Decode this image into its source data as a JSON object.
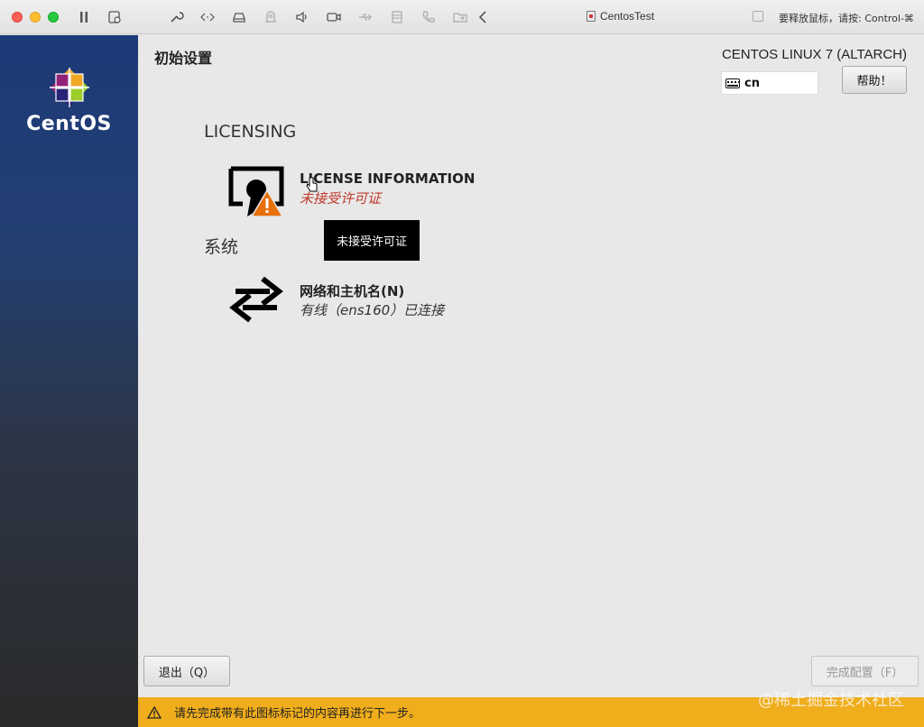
{
  "window": {
    "title": "CentosTest",
    "release_hint": "要释放鼠标，请按: Control-⌘"
  },
  "sidebar": {
    "logo_text": "CentOS"
  },
  "header": {
    "page_title": "初始设置",
    "product": "CENTOS LINUX 7 (ALTARCH)",
    "keyboard_layout": "cn",
    "help_label": "帮助！"
  },
  "sections": [
    {
      "heading": "LICENSING",
      "spokes": [
        {
          "title": "LICENSE INFORMATION",
          "status": "未接受许可证",
          "status_color": "#c0392b",
          "icon": "license-warning-icon"
        }
      ]
    },
    {
      "heading": "系统",
      "spokes": [
        {
          "title": "网络和主机名(N)",
          "status": "有线（ens160）已连接",
          "status_color": "#333333",
          "icon": "network-arrows-icon"
        }
      ]
    }
  ],
  "tooltip": "未接受许可证",
  "footer": {
    "quit_label": "退出（Q）",
    "finish_label": "完成配置（F）"
  },
  "warning_bar": {
    "text": "请先完成带有此图标标记的内容再进行下一步。",
    "color": "#f0ad1c"
  },
  "watermark": "@稀土掘金技术社区"
}
